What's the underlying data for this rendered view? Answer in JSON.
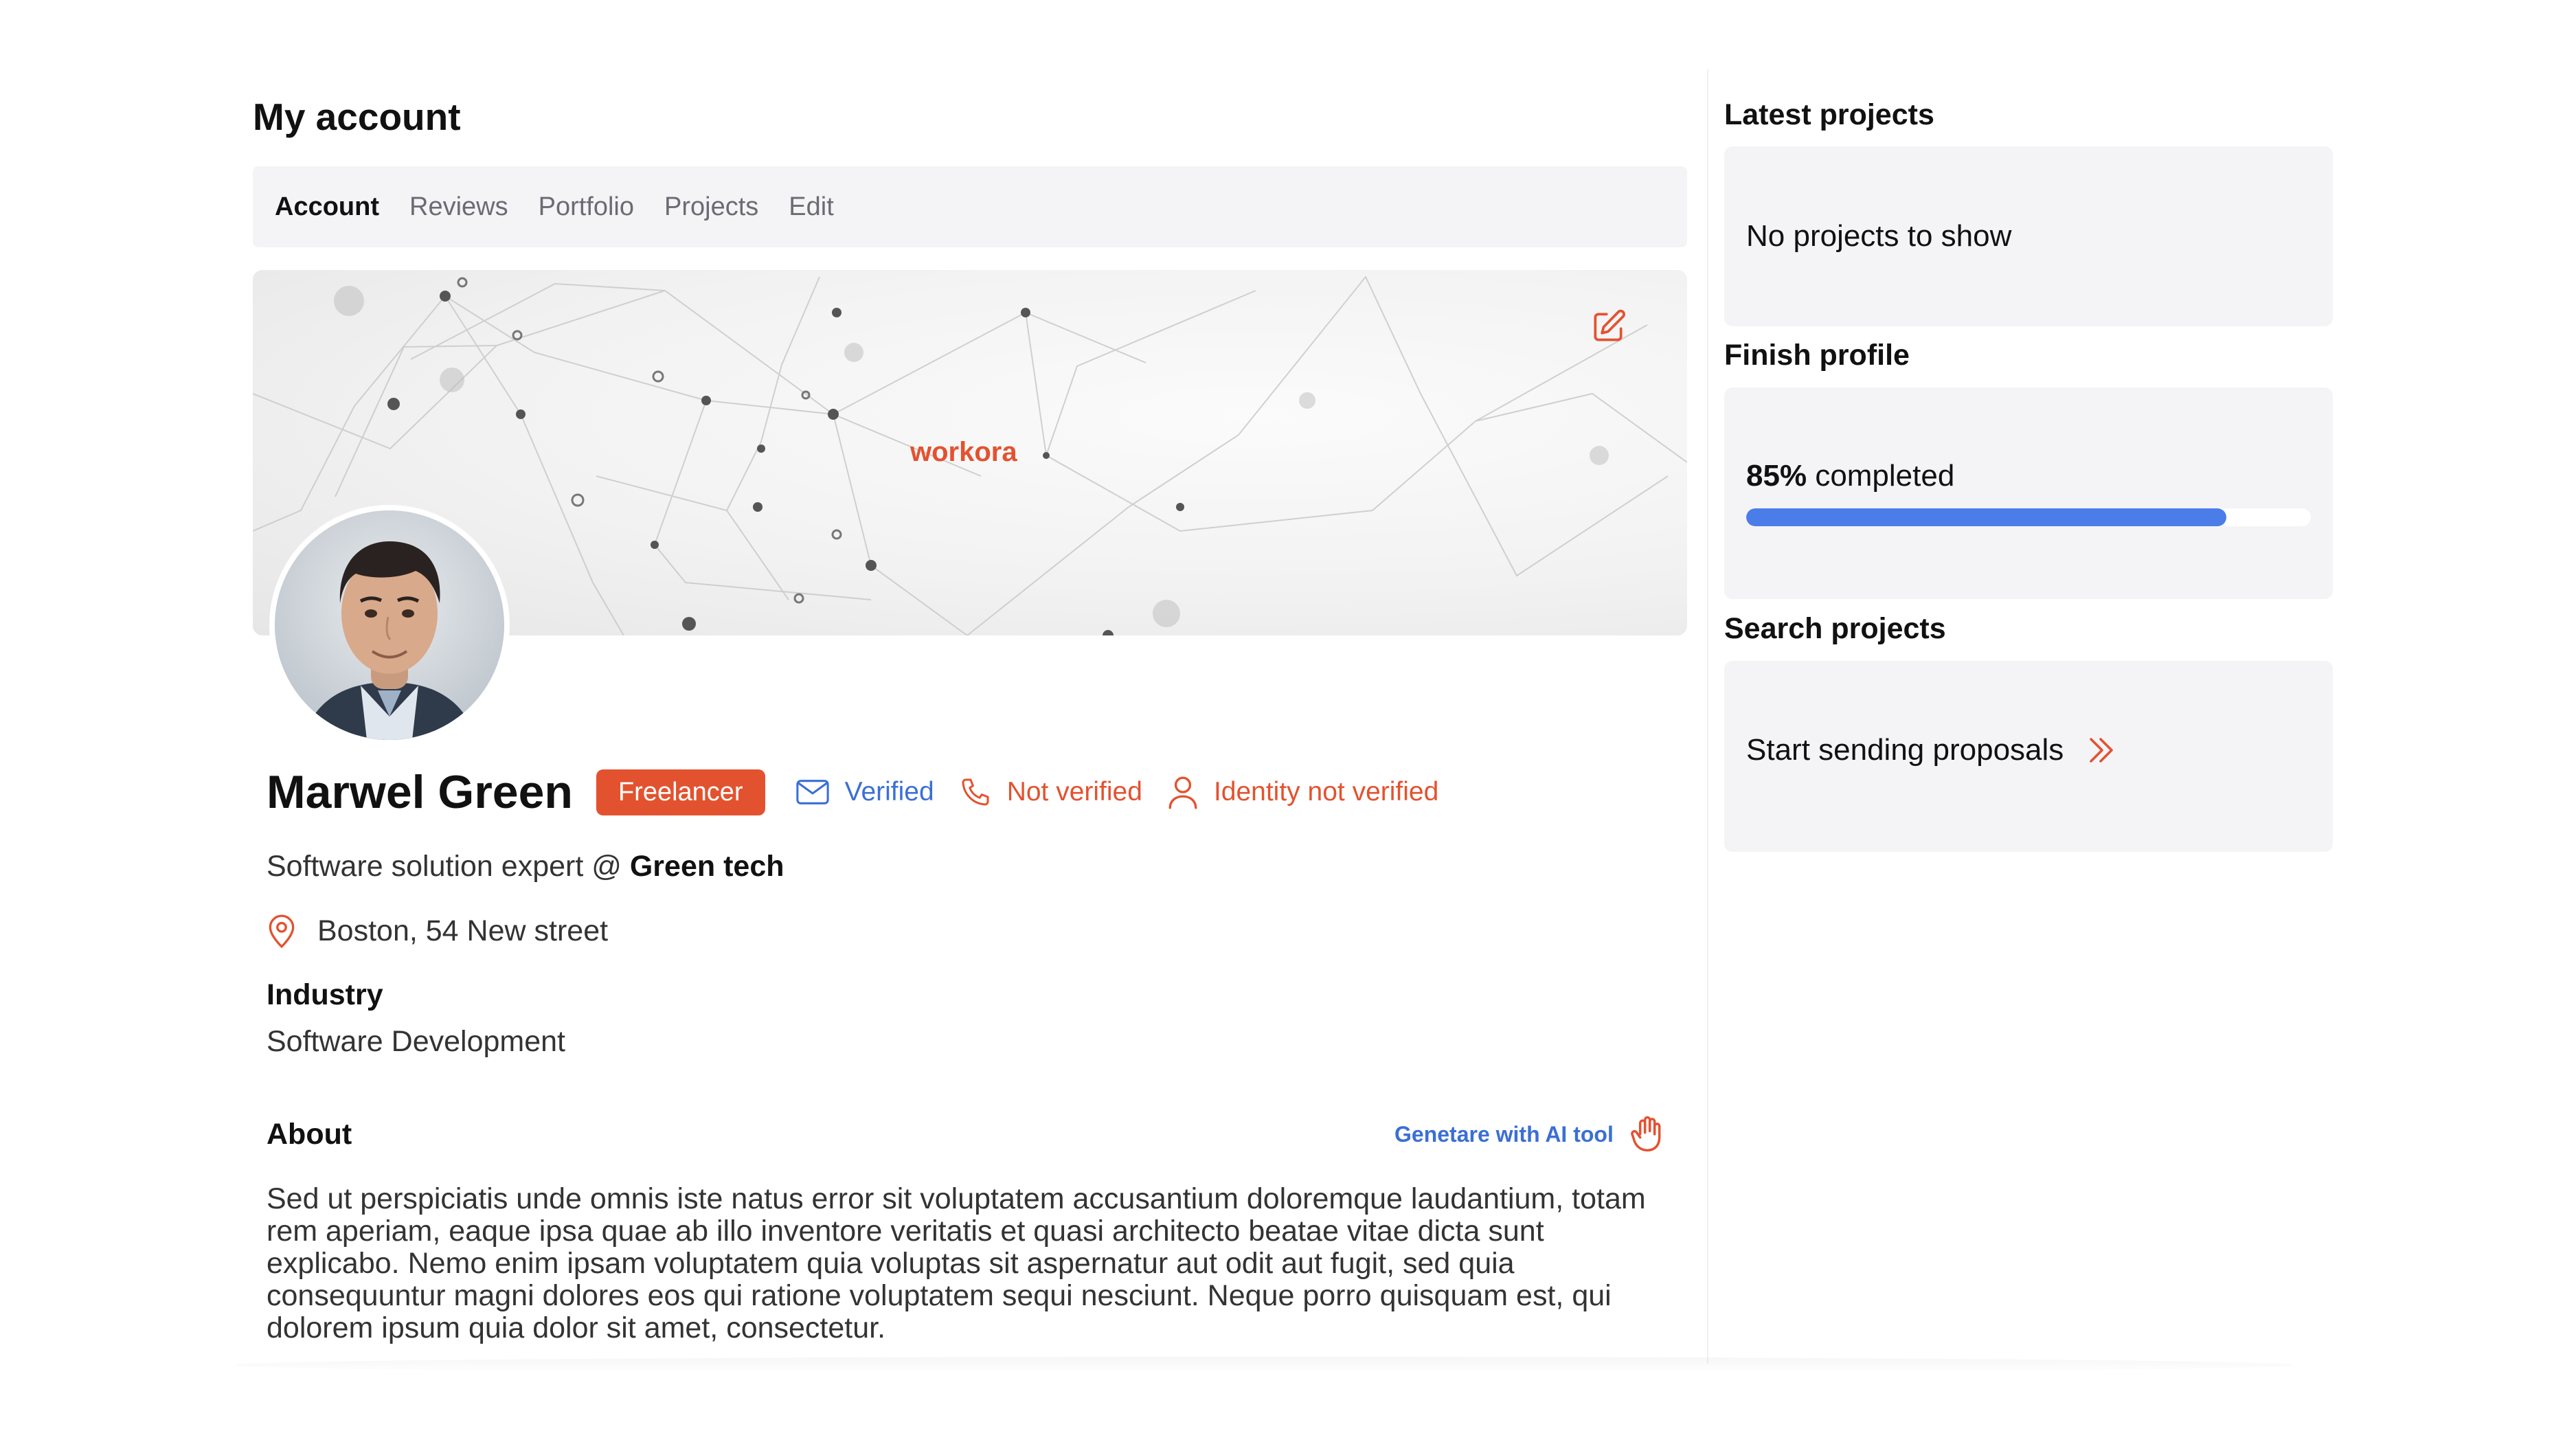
{
  "page": {
    "title": "My account"
  },
  "tabs": [
    {
      "label": "Account",
      "active": true
    },
    {
      "label": "Reviews"
    },
    {
      "label": "Portfolio"
    },
    {
      "label": "Projects"
    },
    {
      "label": "Edit"
    }
  ],
  "banner": {
    "brand": "workora",
    "edit_icon": "pencil-square-icon"
  },
  "profile": {
    "name": "Marwel Green",
    "role_badge": "Freelancer",
    "email_status": "Verified",
    "phone_status": "Not verified",
    "identity_status": "Identity not verified",
    "tagline_prefix": "Software solution expert @",
    "company": "Green tech",
    "location": "Boston, 54 New street",
    "industry_label": "Industry",
    "industry": "Software Development",
    "about_label": "About",
    "ai_tool_label": "Genetare with AI tool",
    "about_text": "Sed ut perspiciatis unde omnis iste natus error sit voluptatem accusantium doloremque laudantium, totam rem aperiam, eaque ipsa quae ab illo inventore veritatis et quasi architecto beatae vitae dicta sunt explicabo. Nemo enim ipsam voluptatem quia voluptas sit aspernatur aut odit aut fugit, sed quia consequuntur magni dolores eos qui ratione voluptatem sequi nesciunt. Neque porro quisquam est, qui dolorem ipsum quia dolor sit amet, consectetur."
  },
  "sidebar": {
    "latest_projects": {
      "title": "Latest projects",
      "empty_text": "No projects to show"
    },
    "finish_profile": {
      "title": "Finish profile",
      "percent_text": "85%",
      "suffix": "completed",
      "progress": 0.85
    },
    "search_projects": {
      "title": "Search projects",
      "cta": "Start sending proposals"
    }
  },
  "colors": {
    "accent": "#e3522f",
    "link": "#3b6fd6",
    "progress": "#4a7de8",
    "card_bg": "#f4f4f7"
  }
}
